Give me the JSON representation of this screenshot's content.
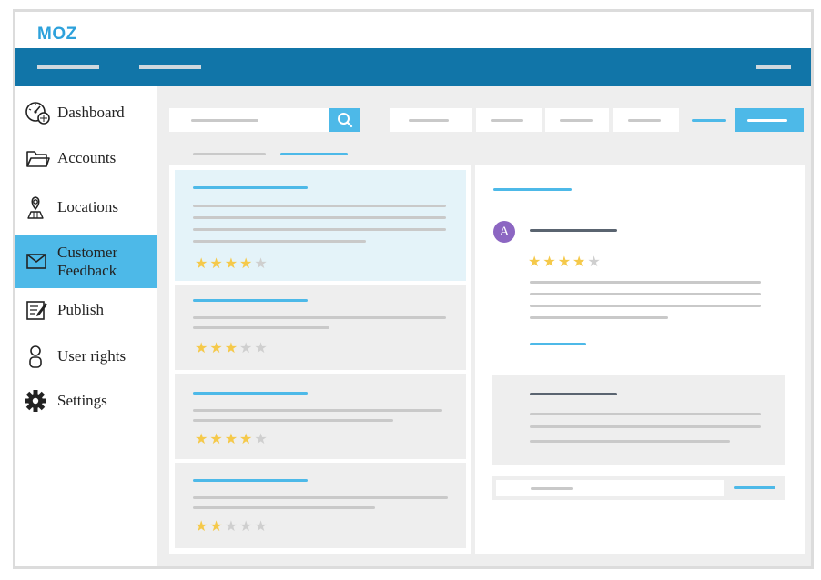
{
  "app": {
    "logo": "MOZ",
    "brand_color": "#2da1db",
    "topbar_color": "#1175a8",
    "accent_color": "#4db9e8"
  },
  "sidebar": {
    "items": [
      {
        "label": "Dashboard",
        "icon": "dashboard-gauge-icon",
        "active": false
      },
      {
        "label": "Accounts",
        "icon": "folder-icon",
        "active": false
      },
      {
        "label": "Locations",
        "icon": "location-pin-icon",
        "active": false
      },
      {
        "label": "Customer Feedback",
        "icon": "envelope-icon",
        "active": true
      },
      {
        "label": "Publish",
        "icon": "edit-document-icon",
        "active": false
      },
      {
        "label": "User rights",
        "icon": "user-icon",
        "active": false
      },
      {
        "label": "Settings",
        "icon": "gear-icon",
        "active": false
      }
    ]
  },
  "toolbar": {
    "search_icon": "search-icon"
  },
  "reviews": [
    {
      "rating": 4,
      "selected": true
    },
    {
      "rating": 3,
      "selected": false
    },
    {
      "rating": 4,
      "selected": false
    },
    {
      "rating": 2,
      "selected": false
    }
  ],
  "detail": {
    "avatar_initial": "A",
    "avatar_color": "#8c66c2",
    "rating": 4
  }
}
